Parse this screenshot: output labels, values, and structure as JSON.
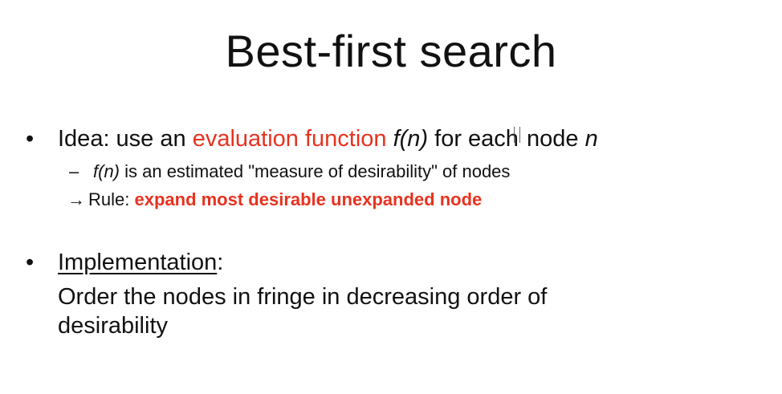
{
  "slide": {
    "title": "Best-first search",
    "bullet1": {
      "bullet": "•",
      "prefix": "Idea: use an ",
      "highlight": "evaluation function",
      "space1": " ",
      "func": "f(n)",
      "mid": " for each",
      "suffix": " node ",
      "var": "n"
    },
    "sub1": {
      "dash": "–",
      "func": "f(n)",
      "text": " is an estimated \"measure of desirability\" of nodes"
    },
    "sub2": {
      "arrow": "→",
      "label": "Rule: ",
      "rule": "expand most desirable unexpanded node"
    },
    "bullet2": {
      "bullet": "•",
      "heading": "Implementation",
      "colon": ":"
    },
    "paragraph": "Order the nodes in fringe in decreasing order of desirability"
  }
}
